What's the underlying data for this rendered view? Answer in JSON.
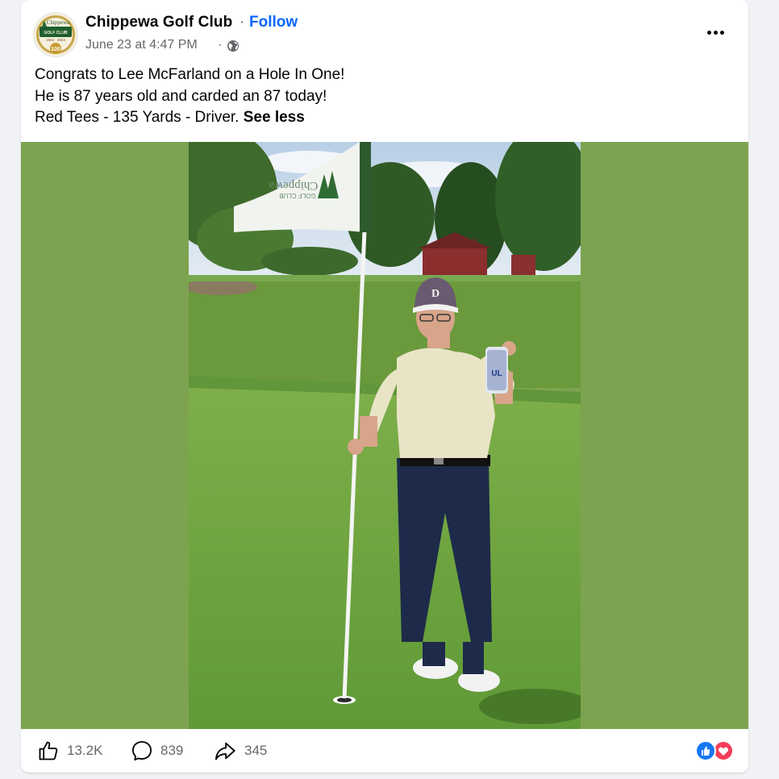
{
  "post": {
    "page_name": "Chippewa Golf Club",
    "separator": "·",
    "follow_label": "Follow",
    "timestamp": "June 23 at 4:47 PM",
    "timestamp_separator": "·",
    "audience_icon": "globe-icon",
    "more_icon": "more-horizontal-icon",
    "avatar": {
      "logo_title": "Chippewa",
      "logo_subtitle": "GOLF CLUB",
      "logo_years": "1924 - 2024",
      "logo_badge": "100"
    },
    "caption": {
      "line1": "Congrats to Lee McFarland on a Hole In One!",
      "line2": "He is 87 years old and carded an 87 today!",
      "line3": "Red Tees - 135 Yards - Driver.",
      "see_less": "See less"
    },
    "photo": {
      "flag_text_1": "Chippewa",
      "flag_text_2": "GOLF CLUB",
      "cap_logo": "D",
      "can_text": "UL"
    },
    "footer": {
      "likes": "13.2K",
      "comments": "839",
      "shares": "345",
      "like_icon": "thumbs-up-icon",
      "comment_icon": "comment-bubble-icon",
      "share_icon": "share-arrow-icon",
      "reaction_icons": [
        "like-reaction-icon",
        "love-reaction-icon"
      ]
    },
    "colors": {
      "accent": "#0866ff",
      "media_background": "#7da350",
      "secondary_text": "#65676b"
    }
  }
}
